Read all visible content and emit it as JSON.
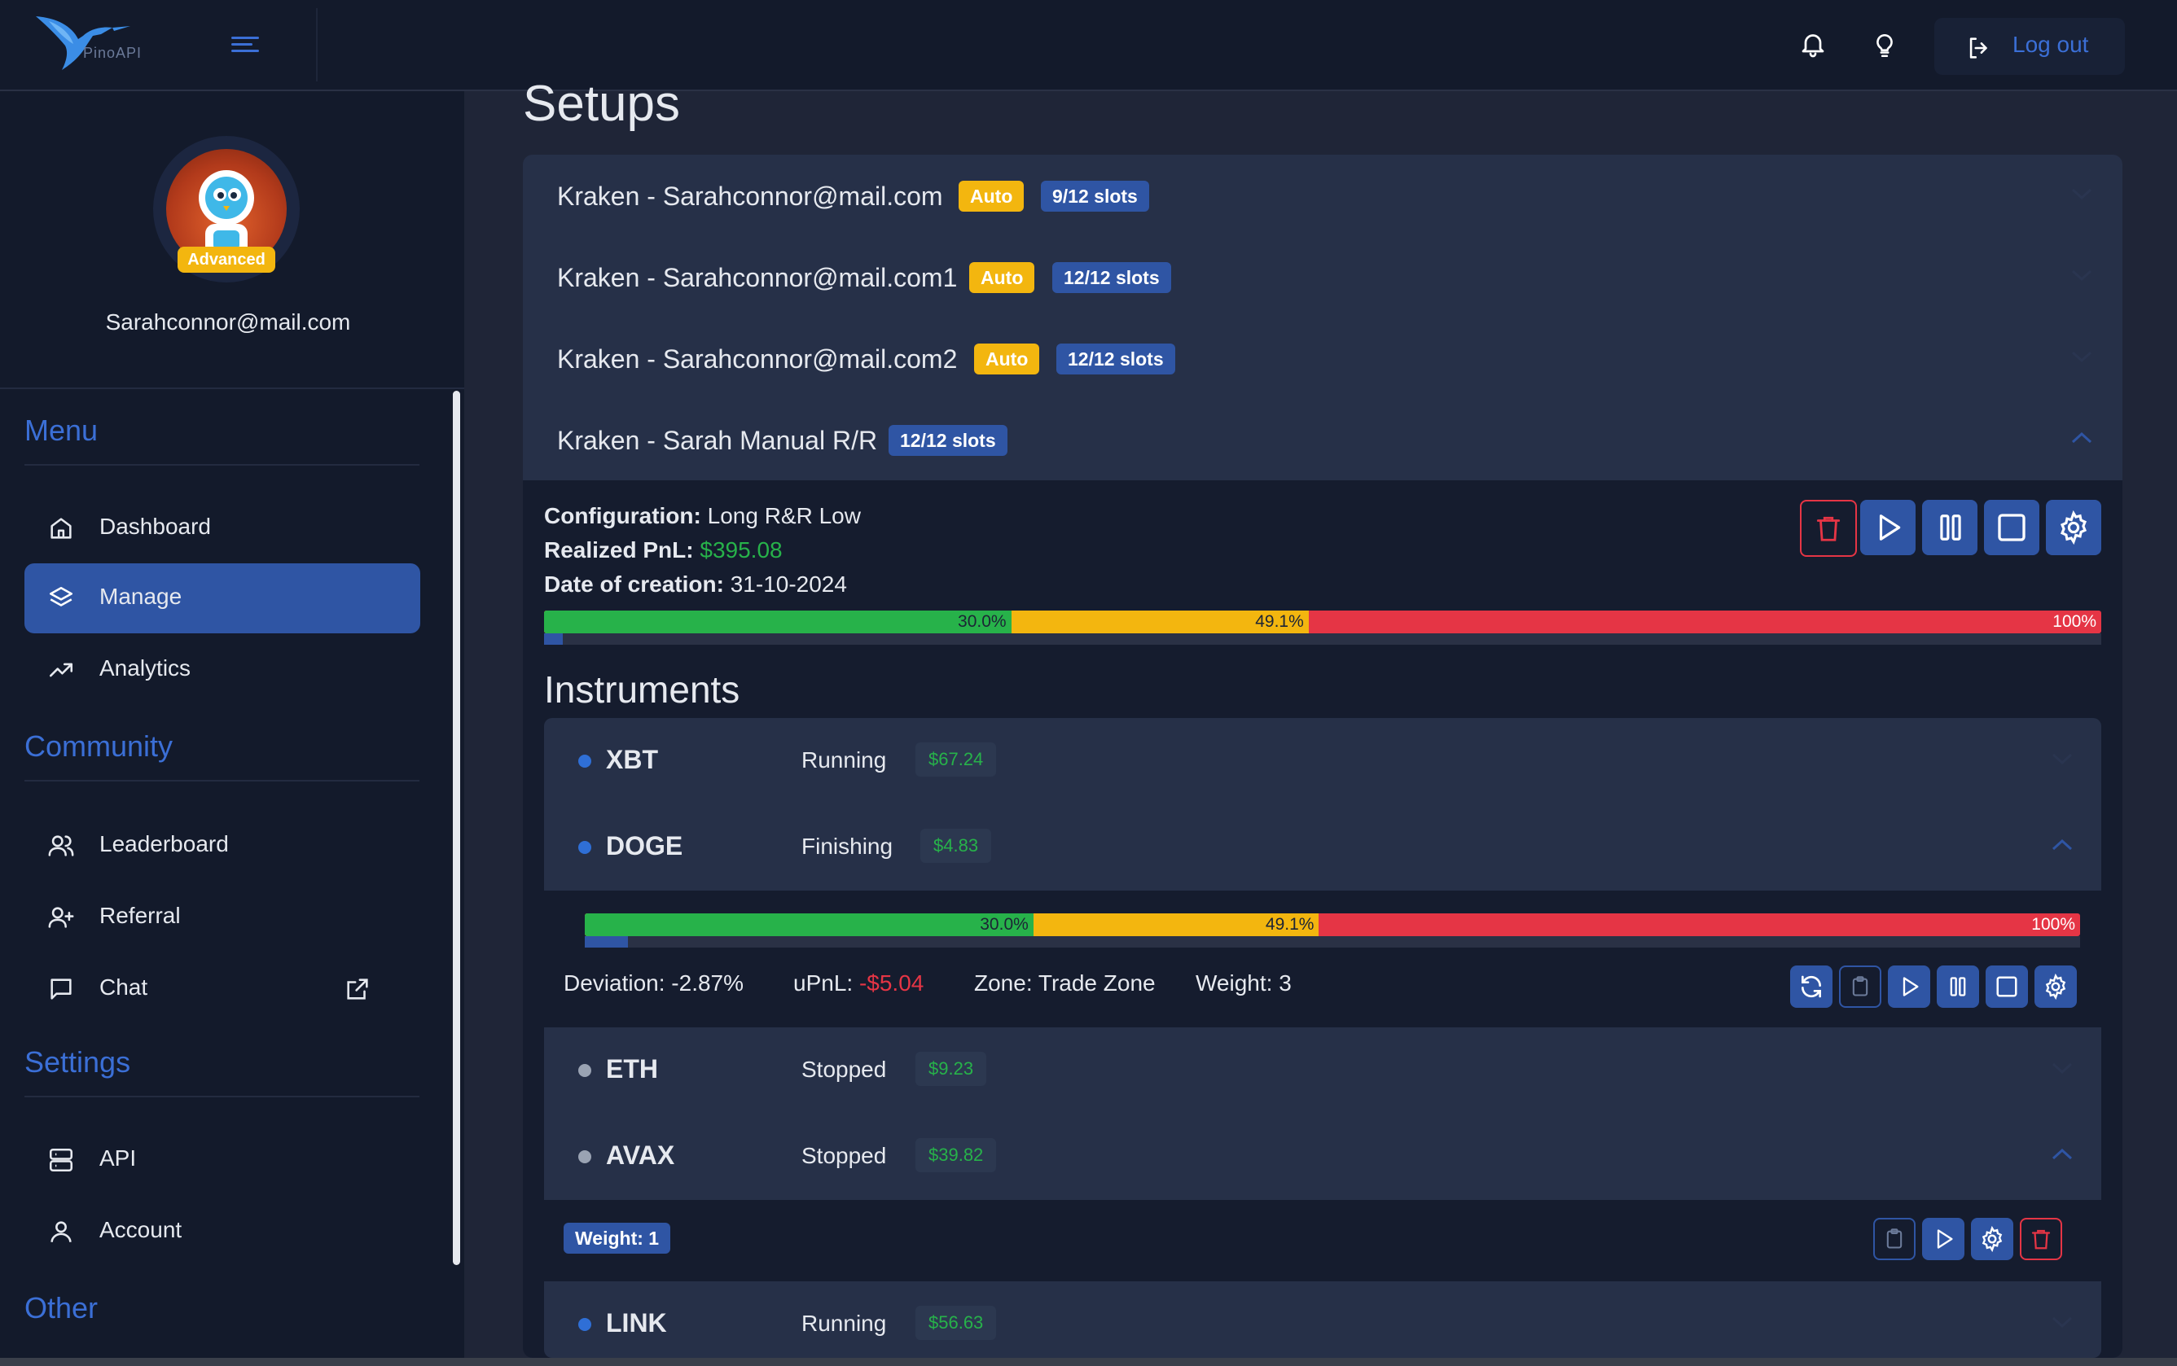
{
  "app": {
    "logo_text": "PinoAPI"
  },
  "topbar": {
    "logout_label": "Log out"
  },
  "user": {
    "badge": "Advanced",
    "email": "Sarahconnor@mail.com"
  },
  "sidebar": {
    "menu_title": "Menu",
    "community_title": "Community",
    "settings_title": "Settings",
    "other_title": "Other",
    "items": {
      "dashboard": "Dashboard",
      "manage": "Manage",
      "analytics": "Analytics",
      "leaderboard": "Leaderboard",
      "referral": "Referral",
      "chat": "Chat",
      "api": "API",
      "account": "Account"
    }
  },
  "main": {
    "title": "Setups",
    "setups": [
      {
        "name": "Kraken - Sarahconnor@mail.com",
        "auto": "Auto",
        "slots": "9/12 slots"
      },
      {
        "name": "Kraken - Sarahconnor@mail.com1",
        "auto": "Auto",
        "slots": "12/12 slots"
      },
      {
        "name": "Kraken - Sarahconnor@mail.com2",
        "auto": "Auto",
        "slots": "12/12 slots"
      },
      {
        "name": "Kraken - Sarah Manual R/R",
        "slots": "12/12 slots"
      }
    ],
    "expanded": {
      "config_label": "Configuration:",
      "config_value": "Long R&R Low",
      "pnl_label": "Realized PnL:",
      "pnl_value": "$395.08",
      "date_label": "Date of creation:",
      "date_value": "31-10-2024",
      "bar": {
        "green_pct": 30.0,
        "yellow_pct": 49.1,
        "red_pct": 100,
        "green_label": "30.0%",
        "yellow_label": "49.1%",
        "red_label": "100%",
        "progress_fraction": 0.012
      },
      "instruments_title": "Instruments",
      "instruments": [
        {
          "symbol": "XBT",
          "status": "Running",
          "pnl": "$67.24",
          "dot": "#2f6fd6"
        },
        {
          "symbol": "DOGE",
          "status": "Finishing",
          "pnl": "$4.83",
          "dot": "#2f6fd6"
        },
        {
          "symbol": "ETH",
          "status": "Stopped",
          "pnl": "$9.23",
          "dot": "#9aa3b3"
        },
        {
          "symbol": "AVAX",
          "status": "Stopped",
          "pnl": "$39.82",
          "dot": "#9aa3b3"
        },
        {
          "symbol": "LINK",
          "status": "Running",
          "pnl": "$56.63",
          "dot": "#2f6fd6"
        }
      ],
      "doge_details": {
        "bar": {
          "green_pct": 30.0,
          "yellow_pct": 49.1,
          "red_pct": 100,
          "green_label": "30.0%",
          "yellow_label": "49.1%",
          "red_label": "100%",
          "progress_fraction": 0.029
        },
        "deviation_label": "Deviation:",
        "deviation_value": "-2.87%",
        "upnl_label": "uPnL:",
        "upnl_value": "-$5.04",
        "zone_label": "Zone:",
        "zone_value": "Trade Zone",
        "weight_label": "Weight:",
        "weight_value": "3"
      },
      "avax_details": {
        "weight": "Weight: 1"
      }
    }
  },
  "colors": {
    "accent": "#2f55a4",
    "auto": "#f3b60f",
    "green": "#27b24a",
    "red": "#e53545"
  }
}
